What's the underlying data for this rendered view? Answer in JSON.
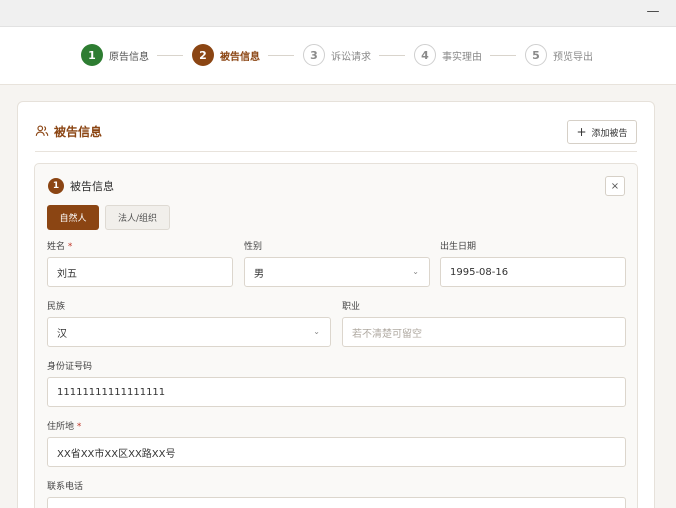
{
  "window": {
    "minimize_glyph": "—"
  },
  "steps": [
    {
      "num": "1",
      "label": "原告信息"
    },
    {
      "num": "2",
      "label": "被告信息"
    },
    {
      "num": "3",
      "label": "诉讼请求"
    },
    {
      "num": "4",
      "label": "事实理由"
    },
    {
      "num": "5",
      "label": "预览导出"
    }
  ],
  "section": {
    "title": "被告信息",
    "icon": "users-icon",
    "add_button_label": "添加被告",
    "add_button_icon": "+"
  },
  "defendant": {
    "index": "1",
    "title": "被告信息",
    "close_glyph": "×",
    "tabs": {
      "natural": "自然人",
      "legal": "法人/组织"
    },
    "labels": {
      "name": "姓名",
      "gender": "性别",
      "birth": "出生日期",
      "ethnicity": "民族",
      "occupation": "职业",
      "id_number": "身份证号码",
      "address": "住所地",
      "phone": "联系电话",
      "required_mark": "*"
    },
    "values": {
      "name": "刘五",
      "gender": "男",
      "birth": "1995-08-16",
      "ethnicity": "汉",
      "occupation_placeholder": "若不清楚可留空",
      "id_number": "11111111111111111",
      "address": "XX省XX市XX区XX路XX号"
    },
    "select_chevron": "⌄"
  },
  "colors": {
    "accent": "#8b4513",
    "done": "#2e7d32",
    "required": "#c0392b"
  }
}
